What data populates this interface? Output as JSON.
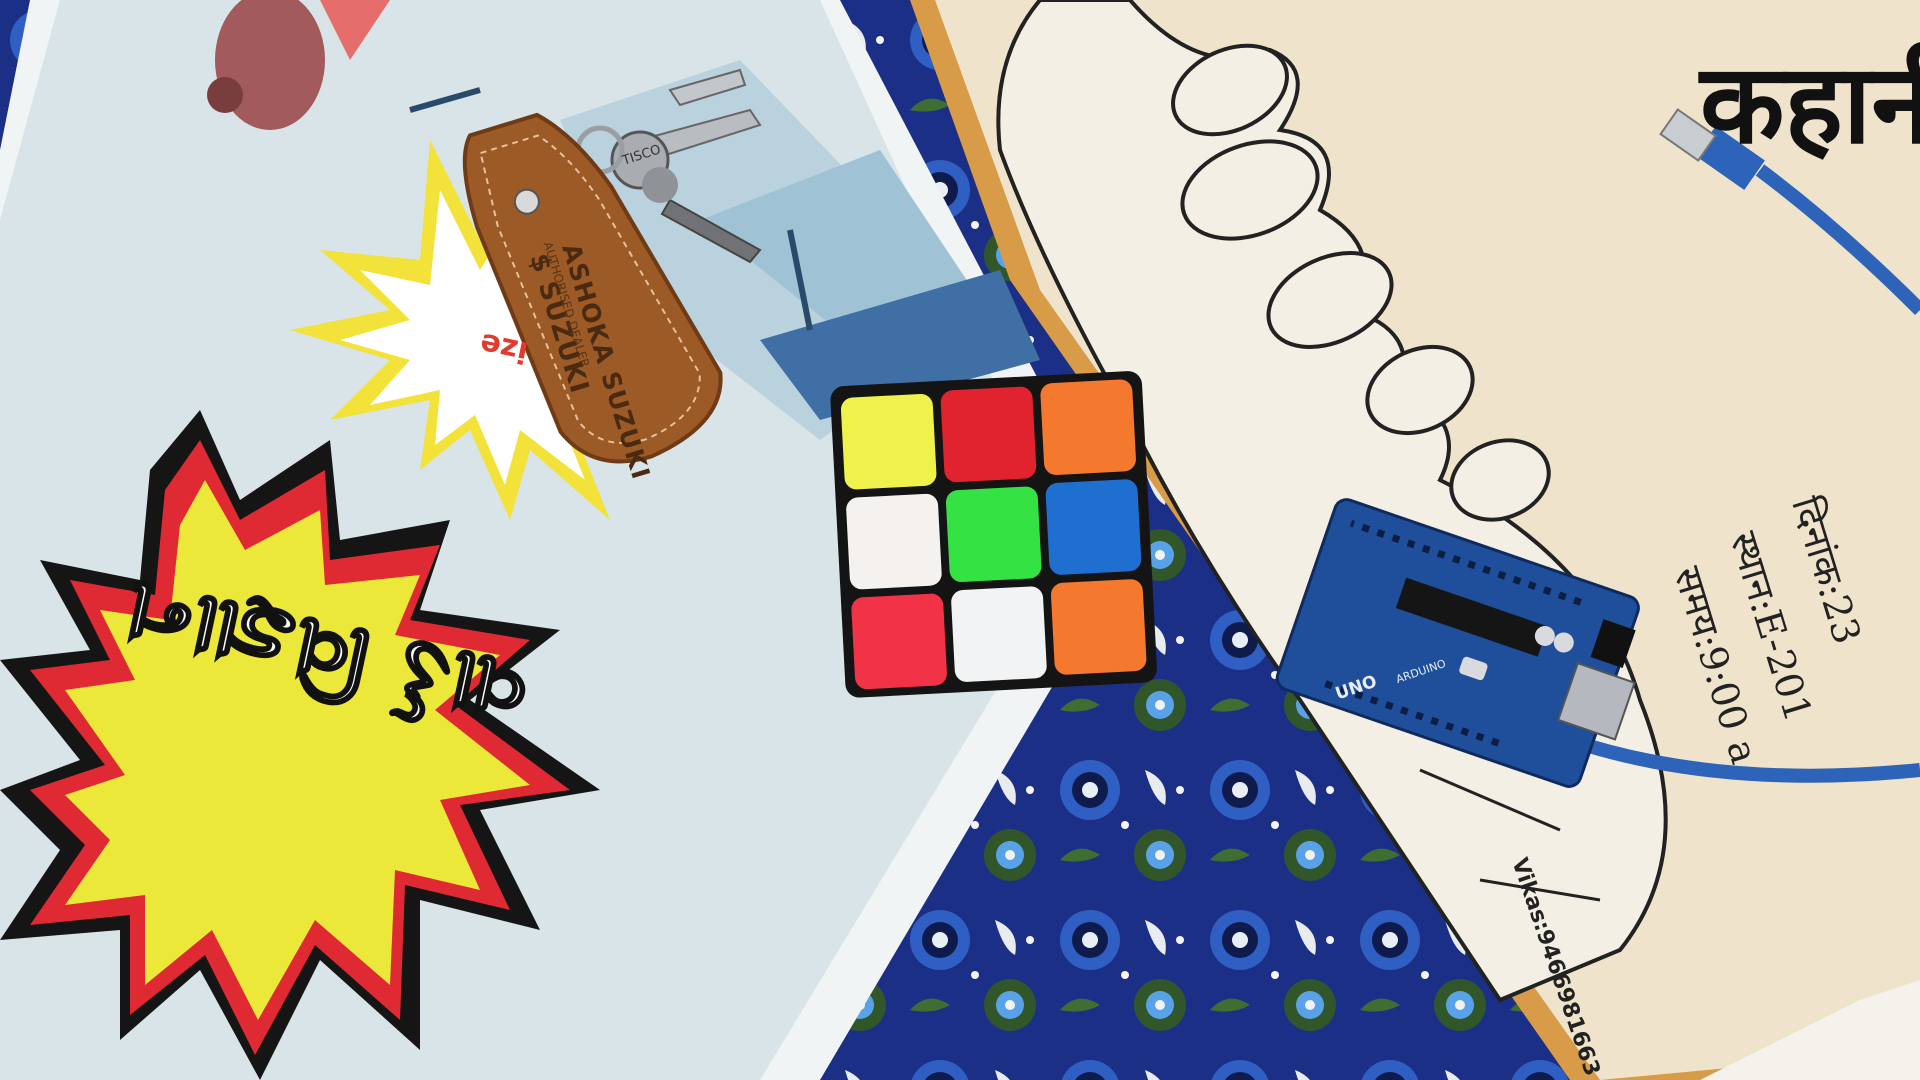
{
  "poster": {
    "headline": "વાર્ડ વિજ્ઞાન",
    "burst_text": "ize"
  },
  "keychain": {
    "brand": "$ SUZUKI",
    "dealer": "ASHOKA SUZUKI",
    "address": "AUTHORISED DEALER"
  },
  "key_tag": "TISCO",
  "event_poster": {
    "title": "कहानी",
    "date_label": "दिनांक:23",
    "place_label": "स्थान:E-201",
    "time_label": "समय:9:00 a",
    "contact": "Vikas:9466981663"
  },
  "arduino": {
    "model": "UNO",
    "brand": "ARDUINO"
  },
  "colors": {
    "table_cloth": "#1b2f86",
    "poster_paper": "#dde6ea",
    "burst_yellow": "#ece83a",
    "burst_red": "#e02a33",
    "beige_paper": "#efe4cb",
    "cork_border": "#d9a65c",
    "board_blue": "#1f4f9a",
    "cable_blue": "#2d63b9"
  },
  "objects": [
    "rubiks-cube",
    "key-fob",
    "keys",
    "arduino-uno-board",
    "usb-cable",
    "comic-poster",
    "hindi-event-poster",
    "paisley-cloth"
  ]
}
